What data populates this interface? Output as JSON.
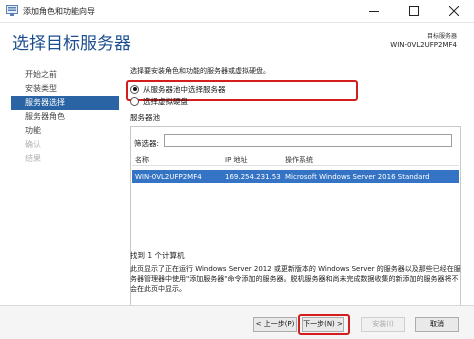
{
  "window": {
    "title": "添加角色和功能向导"
  },
  "header": {
    "page_title": "选择目标服务器",
    "destination_label": "目标服务器",
    "destination_server": "WIN-0VL2UFP2MF4"
  },
  "sidebar": {
    "items": [
      {
        "label": "开始之前",
        "state": "normal"
      },
      {
        "label": "安装类型",
        "state": "normal"
      },
      {
        "label": "服务器选择",
        "state": "active"
      },
      {
        "label": "服务器角色",
        "state": "normal"
      },
      {
        "label": "功能",
        "state": "normal"
      },
      {
        "label": "确认",
        "state": "disabled"
      },
      {
        "label": "结果",
        "state": "disabled"
      }
    ]
  },
  "main": {
    "description": "选择要安装角色和功能的服务器或虚拟硬盘。",
    "options": [
      {
        "label": "从服务器池中选择服务器",
        "checked": true
      },
      {
        "label": "选择虚拟硬盘",
        "checked": false
      }
    ],
    "pool_label": "服务器池",
    "filter_label": "筛选器:",
    "filter_value": "",
    "columns": [
      "名称",
      "IP 地址",
      "操作系统"
    ],
    "rows": [
      {
        "name": "WIN-0VL2UFP2MF4",
        "ip": "169.254.231.53",
        "os": "Microsoft Windows Server 2016 Standard"
      }
    ],
    "found_text": "找到 1 个计算机",
    "info_text": "此页显示了正在运行 Windows Server 2012 或更新版本的 Windows Server 的服务器以及那些已经在服务器管理器中使用\"添加服务器\"命令添加的服务器。脱机服务器和尚未完成数据收集的新添加的服务器将不会在此页中显示。"
  },
  "footer": {
    "prev_label": "< 上一步(P)",
    "next_label": "下一步(N) >",
    "install_label": "安装(I)",
    "cancel_label": "取消"
  },
  "colors": {
    "accent": "#2a64a4",
    "title": "#1b4d8f",
    "selection": "#3574c4",
    "highlight": "#d21e1e"
  }
}
